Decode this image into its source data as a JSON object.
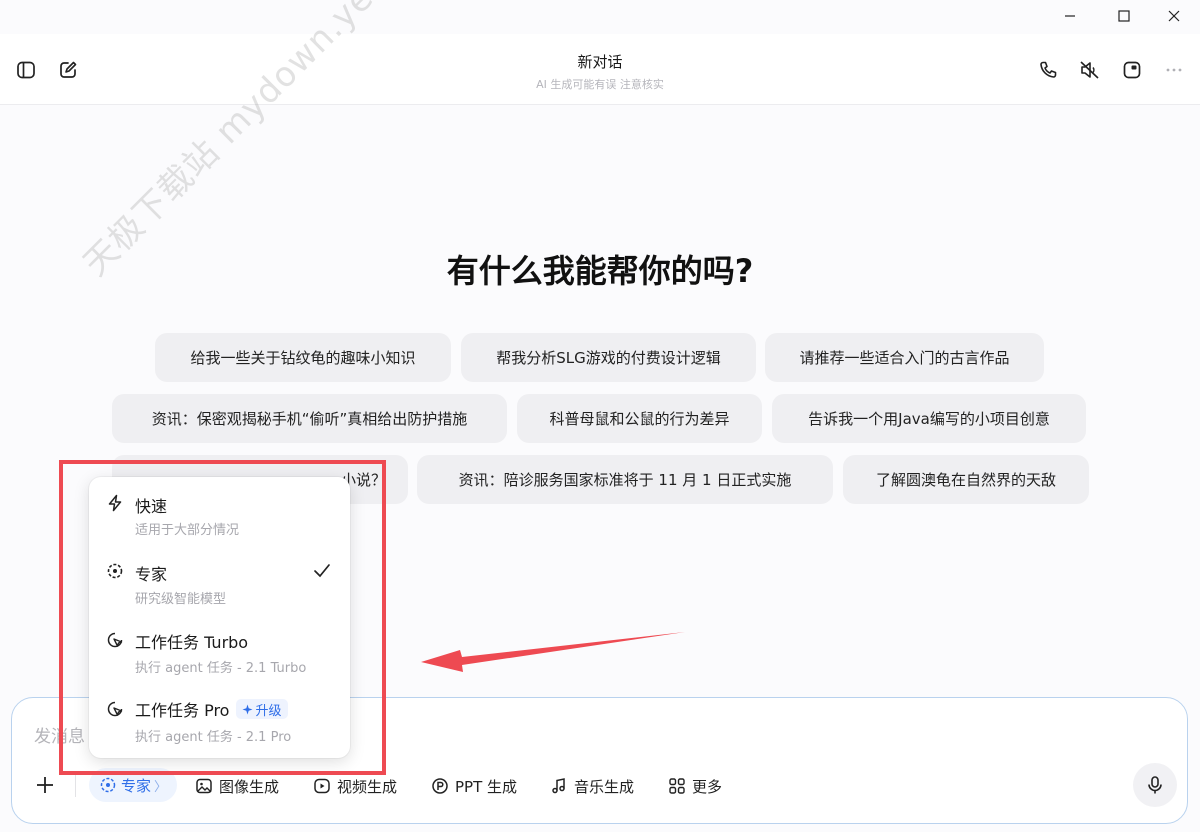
{
  "window": {
    "controls": [
      "minimize-icon",
      "maximize-icon",
      "close-icon"
    ]
  },
  "header": {
    "title": "新对话",
    "subtitle": "AI 生成可能有误 注意核实",
    "left_icons": [
      "sidebar-toggle-icon",
      "new-chat-icon"
    ],
    "right_icons": [
      "phone-icon",
      "mute-icon",
      "window-icon",
      "more-icon"
    ]
  },
  "watermark": "天极下载站 mydown.yesky.com",
  "main": {
    "headline": "有什么我能帮你的吗?",
    "suggestions": [
      "给我一些关于钻纹龟的趣味小知识",
      "帮我分析SLG游戏的付费设计逻辑",
      "请推荐一些适合入门的古言作品",
      "资讯：保密观揭秘手机“偷听”真相给出防护措施",
      "科普母鼠和公鼠的行为差异",
      "告诉我一个用Java编写的小项目创意",
      "小说？",
      "资讯：陪诊服务国家标准将于 11 月 1 日正式实施",
      "了解圆澳龟在自然界的天敌"
    ]
  },
  "composer": {
    "placeholder": "发消息",
    "add_label": "+",
    "mode_label": "专家",
    "tools": [
      {
        "label": "图像生成",
        "icon": "image-icon"
      },
      {
        "label": "视频生成",
        "icon": "video-icon"
      },
      {
        "label": "PPT 生成",
        "icon": "ppt-icon"
      },
      {
        "label": "音乐生成",
        "icon": "music-icon"
      },
      {
        "label": "更多",
        "icon": "grid-icon"
      }
    ],
    "mic_icon": "microphone-icon"
  },
  "mode_menu": {
    "options": [
      {
        "title": "快速",
        "desc": "适用于大部分情况",
        "icon": "lightning-icon",
        "selected": false
      },
      {
        "title": "专家",
        "desc": "研究级智能模型",
        "icon": "expert-icon",
        "selected": true
      },
      {
        "title": "工作任务 Turbo",
        "desc": "执行 agent 任务 - 2.1 Turbo",
        "icon": "agent-icon",
        "selected": false
      },
      {
        "title": "工作任务 Pro",
        "desc": "执行 agent 任务 - 2.1 Pro",
        "icon": "agent-icon",
        "selected": false,
        "badge": "升级"
      }
    ]
  },
  "annotation": {
    "color": "#ee4a52"
  },
  "colors": {
    "accent": "#2f6ee8",
    "chip_bg": "#efeff2",
    "composer_border": "#b9d2ee"
  }
}
